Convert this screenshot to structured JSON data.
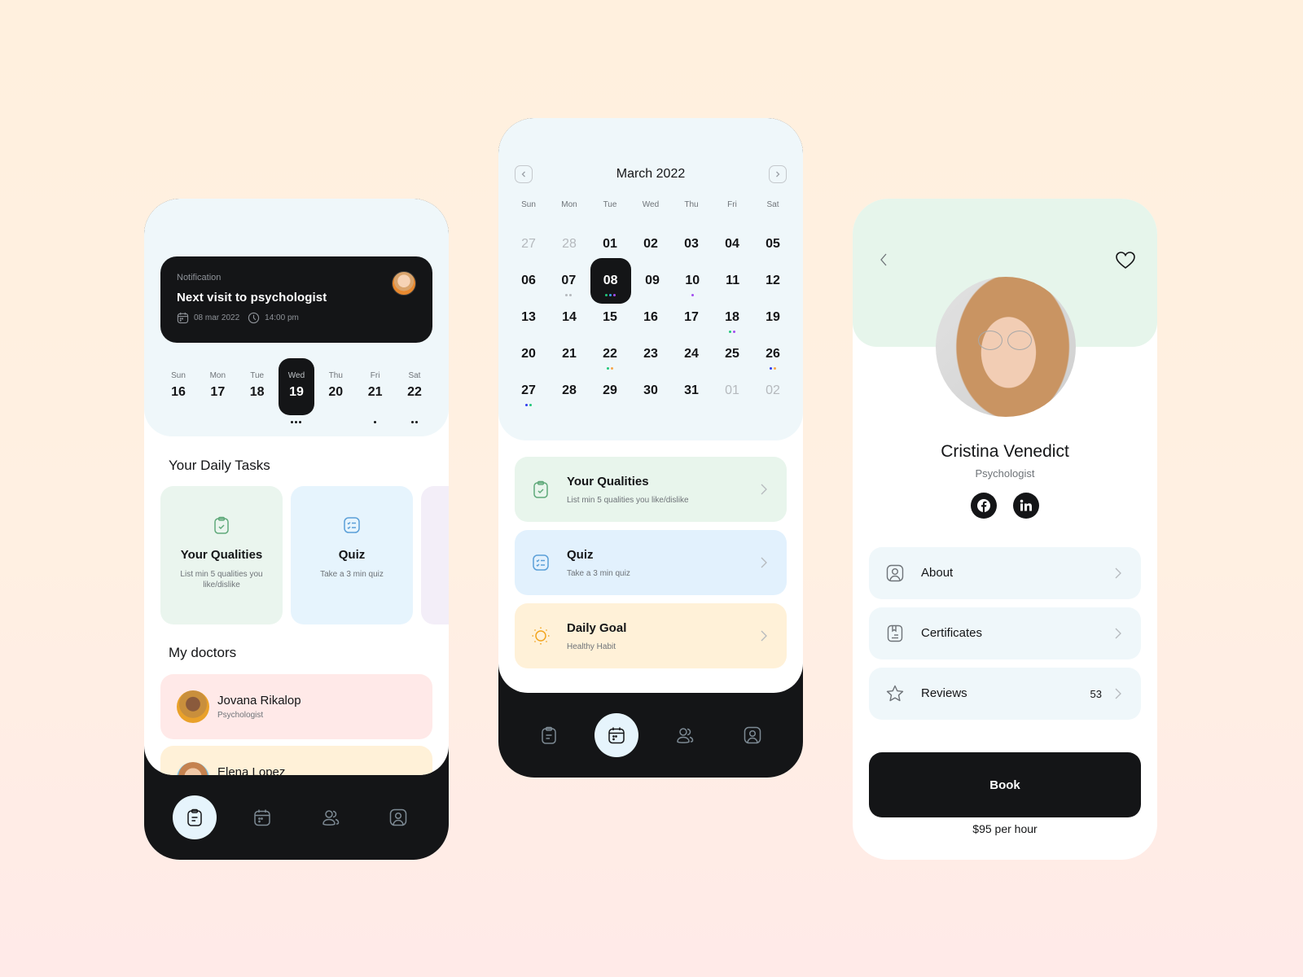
{
  "colors": {
    "dark": "#141517",
    "light_blue_bg": "#eff7fa",
    "green_card": "#e8f5ec",
    "blue_card": "#e4f3fd",
    "purple_card": "#f3eef8",
    "pink_card": "#ffe9e8",
    "yellow_card": "#fff1d8",
    "profile_header": "#e6f5eb",
    "dot_green": "#22c77a",
    "dot_blue": "#3aa0f0",
    "dot_purple": "#a24cf0",
    "dot_orange": "#f7a64a",
    "dot_navy": "#2f3bf0",
    "dot_gray": "#b5b9bd"
  },
  "home": {
    "notification": {
      "label": "Notification",
      "title": "Next visit to psychologist",
      "date": "08 mar 2022",
      "time": "14:00 pm",
      "calendar_icon": "calendar-icon",
      "clock_icon": "clock-icon"
    },
    "week": [
      {
        "dow": "Sun",
        "date": "16",
        "dots": 0
      },
      {
        "dow": "Mon",
        "date": "17",
        "dots": 0
      },
      {
        "dow": "Tue",
        "date": "18",
        "dots": 0
      },
      {
        "dow": "Wed",
        "date": "19",
        "dots": 3,
        "selected": true
      },
      {
        "dow": "Thu",
        "date": "20",
        "dots": 0
      },
      {
        "dow": "Fri",
        "date": "21",
        "dots": 1
      },
      {
        "dow": "Sat",
        "date": "22",
        "dots": 2
      }
    ],
    "daily_tasks_title": "Your Daily Tasks",
    "tasks": [
      {
        "title": "Your Qualities",
        "subtitle": "List min 5 qualities you like/dislike",
        "icon": "clipboard-check-icon"
      },
      {
        "title": "Quiz",
        "subtitle": "Take a 3 min quiz",
        "icon": "checklist-icon"
      },
      {
        "title": "",
        "subtitle": "",
        "icon": ""
      }
    ],
    "doctors_title": "My doctors",
    "doctors": [
      {
        "name": "Jovana Rikalop",
        "role": "Psychologist"
      },
      {
        "name": "Elena Lopez",
        "role": ""
      }
    ],
    "tabbar": [
      "clipboard-icon",
      "calendar-icon",
      "users-icon",
      "profile-icon"
    ],
    "active_tab": 0
  },
  "calendar": {
    "month_title": "March 2022",
    "prev_icon": "chevron-left-icon",
    "next_icon": "chevron-right-icon",
    "weekdays": [
      "Sun",
      "Mon",
      "Tue",
      "Wed",
      "Thu",
      "Fri",
      "Sat"
    ],
    "weeks": [
      [
        {
          "d": "27",
          "m": true
        },
        {
          "d": "28",
          "m": true
        },
        {
          "d": "01"
        },
        {
          "d": "02"
        },
        {
          "d": "03"
        },
        {
          "d": "04"
        },
        {
          "d": "05"
        }
      ],
      [
        {
          "d": "06"
        },
        {
          "d": "07",
          "dots": [
            "gray",
            "gray"
          ]
        },
        {
          "d": "08",
          "sel": true,
          "dots": [
            "green",
            "blue",
            "purple"
          ]
        },
        {
          "d": "09"
        },
        {
          "d": "10",
          "dots": [
            "purple"
          ]
        },
        {
          "d": "11"
        },
        {
          "d": "12"
        }
      ],
      [
        {
          "d": "13"
        },
        {
          "d": "14"
        },
        {
          "d": "15"
        },
        {
          "d": "16"
        },
        {
          "d": "17"
        },
        {
          "d": "18",
          "dots": [
            "green",
            "purple"
          ]
        },
        {
          "d": "19"
        }
      ],
      [
        {
          "d": "20"
        },
        {
          "d": "21"
        },
        {
          "d": "22",
          "dots": [
            "green",
            "orange"
          ]
        },
        {
          "d": "23"
        },
        {
          "d": "24"
        },
        {
          "d": "25"
        },
        {
          "d": "26",
          "dots": [
            "navy",
            "orange"
          ]
        }
      ],
      [
        {
          "d": "27",
          "dots": [
            "navy",
            "green"
          ]
        },
        {
          "d": "28"
        },
        {
          "d": "29"
        },
        {
          "d": "30"
        },
        {
          "d": "31"
        },
        {
          "d": "01",
          "m": true
        },
        {
          "d": "02",
          "m": true
        }
      ]
    ],
    "items": [
      {
        "title": "Your Qualities",
        "subtitle": "List min 5 qualities you like/dislike",
        "icon": "clipboard-check-icon"
      },
      {
        "title": "Quiz",
        "subtitle": "Take a 3 min quiz",
        "icon": "checklist-icon"
      },
      {
        "title": "Daily Goal",
        "subtitle": "Healthy Habit",
        "icon": "sun-icon"
      }
    ],
    "tabbar": [
      "clipboard-icon",
      "calendar-icon",
      "users-icon",
      "profile-icon"
    ],
    "active_tab": 1
  },
  "profile": {
    "name": "Cristina Venedict",
    "role": "Psychologist",
    "socials": [
      "facebook-icon",
      "linkedin-icon"
    ],
    "menu": [
      {
        "label": "About",
        "count": "",
        "icon": "user-square-icon"
      },
      {
        "label": "Certificates",
        "count": "",
        "icon": "certificate-icon"
      },
      {
        "label": "Reviews",
        "count": "53",
        "icon": "star-icon"
      }
    ],
    "book_label": "Book",
    "price": "$95 per hour"
  }
}
